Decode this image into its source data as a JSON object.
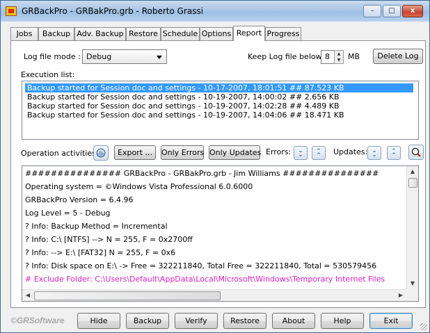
{
  "window": {
    "title": "GRBackPro - GRBakPro.grb - Roberto Grassi",
    "minimize_glyph": "–",
    "maximize_glyph": "□",
    "close_glyph": "x"
  },
  "tabs": [
    {
      "label": "Jobs"
    },
    {
      "label": "Backup"
    },
    {
      "label": "Adv. Backup"
    },
    {
      "label": "Restore"
    },
    {
      "label": "Schedule"
    },
    {
      "label": "Options"
    },
    {
      "label": "Report",
      "active": true
    },
    {
      "label": "Progress"
    }
  ],
  "report": {
    "log_file_mode_label": "Log file mode :",
    "log_file_mode_value": "Debug",
    "keep_log_label": "Keep Log file below :",
    "keep_log_value": "8",
    "keep_log_unit": "MB",
    "delete_log_label": "Delete Log",
    "execution_list_label": "Execution list:",
    "execution_list": [
      {
        "text": "Backup started for Session doc and settings - 10-17-2007, 18:01:51 ## 87.523 KB",
        "selected": true
      },
      {
        "text": "Backup started for Session doc and settings - 10-19-2007, 14:00:02 ## 2.656 KB"
      },
      {
        "text": "Backup started for Session doc and settings - 10-19-2007, 14:02:28 ## 4.489 KB"
      },
      {
        "text": "Backup started for Session doc and settings - 10-19-2007, 14:04:06 ## 18.471 KB"
      }
    ],
    "operation_activities_label": "Operation activities :",
    "export_label": "Export ...",
    "only_errors_label": "Only Errors",
    "only_updates_label": "Only Updates",
    "errors_label": "Errors:",
    "updates_label": "Updates:",
    "log_lines": [
      {
        "text": "############### GRBackPro - GRBakPro.grb - Jim Williams ###############"
      },
      {
        "text": "Operating system = ©Windows Vista Professional 6.0.6000"
      },
      {
        "text": "GRBackPro Version   = 6.4.96"
      },
      {
        "text": "Log Level = 5 - Debug"
      },
      {
        "text": "? Info: Backup Method = Incremental"
      },
      {
        "text": "? Info: C:\\ [NTFS] --> N = 255, F = 0x2700ff"
      },
      {
        "text": "? Info:  --> E:\\ [FAT32] N = 255, F = 0x6"
      },
      {
        "text": "? Info: Disk space on E:\\ -> Free = 322211840, Total Free = 322211840, Total = 530579456"
      },
      {
        "text": "# Exclude Folder: C:\\Users\\Default\\AppData\\Local\\Microsoft\\Windows\\Temporary Internet Files",
        "color": "#e020c0"
      }
    ]
  },
  "footer": {
    "logo_text": "©GRSoftware",
    "buttons": [
      {
        "label": "Hide"
      },
      {
        "label": "Backup"
      },
      {
        "label": "Verify"
      },
      {
        "label": "Restore"
      },
      {
        "label": "About"
      },
      {
        "label": "Help"
      },
      {
        "label": "Exit"
      }
    ]
  },
  "colors": {
    "selection": "#3399ff",
    "exclude_line": "#e020c0"
  }
}
